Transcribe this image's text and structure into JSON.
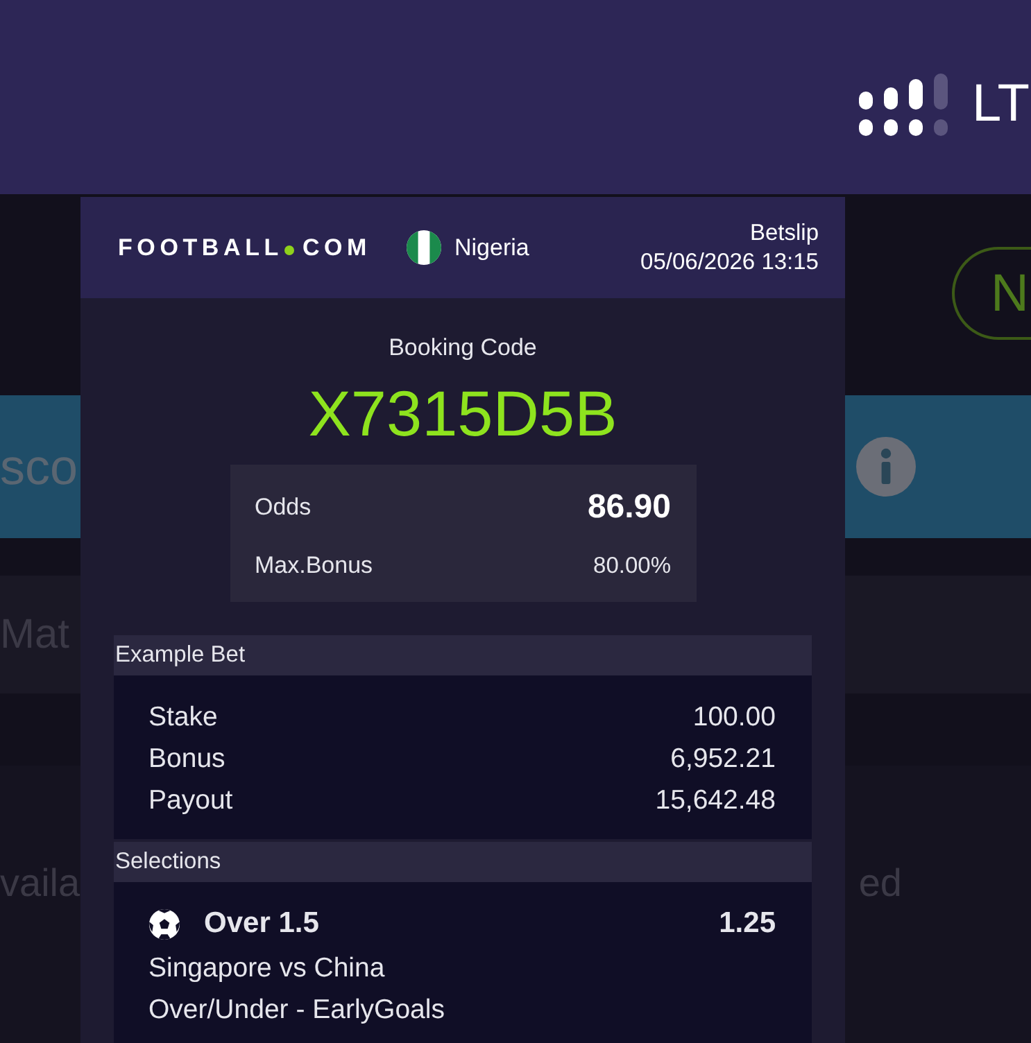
{
  "status_bar": {
    "network": "LT"
  },
  "background": {
    "button_label": "N",
    "banner_text": "sco",
    "row_text": "Mat",
    "footer_left": "vaila",
    "footer_right": "ed"
  },
  "betslip": {
    "header": {
      "logo": {
        "name": "FOOTBALL",
        "domain": "COM"
      },
      "country": "Nigeria",
      "title": "Betslip",
      "datetime": "05/06/2026 13:15"
    },
    "booking": {
      "label": "Booking Code",
      "code": "X7315D5B"
    },
    "summary": [
      {
        "kind": "primary",
        "label": "Odds",
        "value": "86.90"
      },
      {
        "kind": "secondary",
        "label": "Max.Bonus",
        "value": "80.00%"
      }
    ],
    "example_bet": {
      "title": "Example Bet",
      "rows": [
        {
          "label": "Stake",
          "value": "100.00"
        },
        {
          "label": "Bonus",
          "value": "6,952.21"
        },
        {
          "label": "Payout",
          "value": "15,642.48"
        }
      ]
    },
    "selections": {
      "title": "Selections",
      "items": [
        {
          "pick": "Over 1.5",
          "odds": "1.25",
          "match": "Singapore vs China",
          "market": "Over/Under - EarlyGoals"
        }
      ]
    }
  }
}
